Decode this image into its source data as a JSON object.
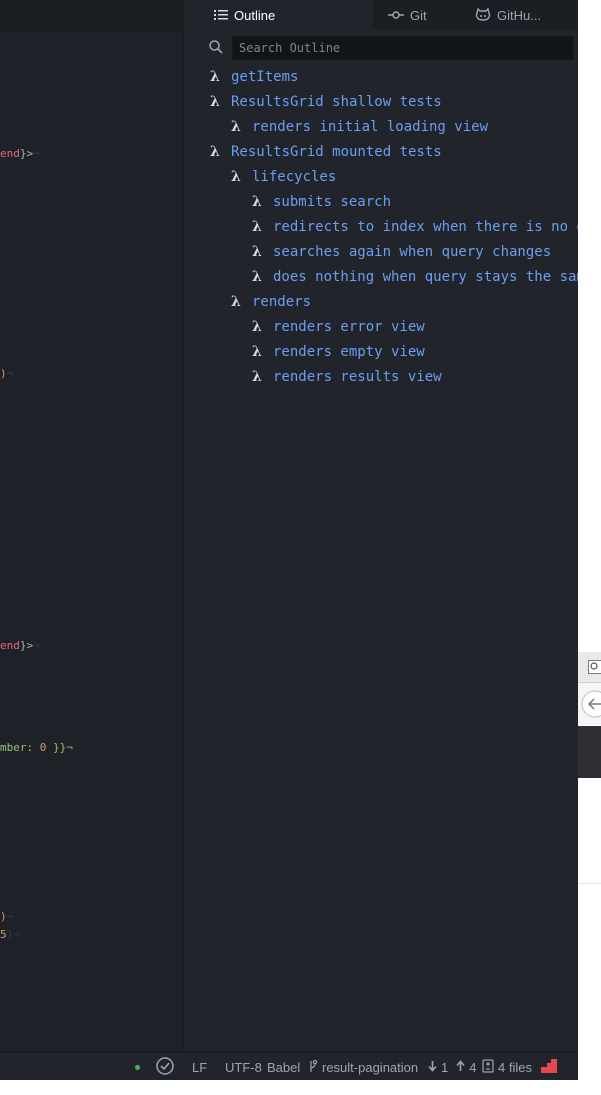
{
  "dock": {
    "tabs": [
      {
        "label": "Outline",
        "icon": "list-icon",
        "active": true
      },
      {
        "label": "Git",
        "icon": "git-commit-icon",
        "active": false
      },
      {
        "label": "GitHu...",
        "icon": "octocat-icon",
        "active": false
      }
    ]
  },
  "outline": {
    "search_placeholder": "Search Outline",
    "items": [
      {
        "label": "getItems",
        "level": 0
      },
      {
        "label": "ResultsGrid shallow tests",
        "level": 0
      },
      {
        "label": "renders initial loading view",
        "level": 1
      },
      {
        "label": "ResultsGrid mounted tests",
        "level": 0
      },
      {
        "label": "lifecycles",
        "level": 1
      },
      {
        "label": "submits search",
        "level": 2
      },
      {
        "label": "redirects to index when there is no q",
        "level": 2
      },
      {
        "label": "searches again when query changes",
        "level": 2
      },
      {
        "label": "does nothing when query stays the sam",
        "level": 2
      },
      {
        "label": "renders",
        "level": 1
      },
      {
        "label": "renders error view",
        "level": 2
      },
      {
        "label": "renders empty view",
        "level": 2
      },
      {
        "label": "renders results view",
        "level": 2
      }
    ]
  },
  "editor": {
    "fragments": [
      {
        "a": "end",
        "b": "}>",
        "c": "¬"
      },
      {
        "a": "",
        "b": ")",
        "c": "¬"
      },
      {
        "a": "end",
        "b": "}>",
        "c": "¬"
      },
      {
        "a": "mber: ",
        "b": "0",
        "c": " }}¬"
      },
      {
        "a": "",
        "b": ")",
        "c": "¬"
      },
      {
        "a": "",
        "b": "5",
        "c": ")¬"
      }
    ]
  },
  "statusbar": {
    "line_ending": "LF",
    "encoding": "UTF-8",
    "grammar": "Babel",
    "branch": "result-pagination",
    "behind": "1",
    "ahead": "4",
    "changed_files": "4 files"
  },
  "colors": {
    "outline_text": "#6b9ef0",
    "lambda": "#d7dae0",
    "status_ok": "#3fb950",
    "changes_indicator": "#e5484d"
  }
}
